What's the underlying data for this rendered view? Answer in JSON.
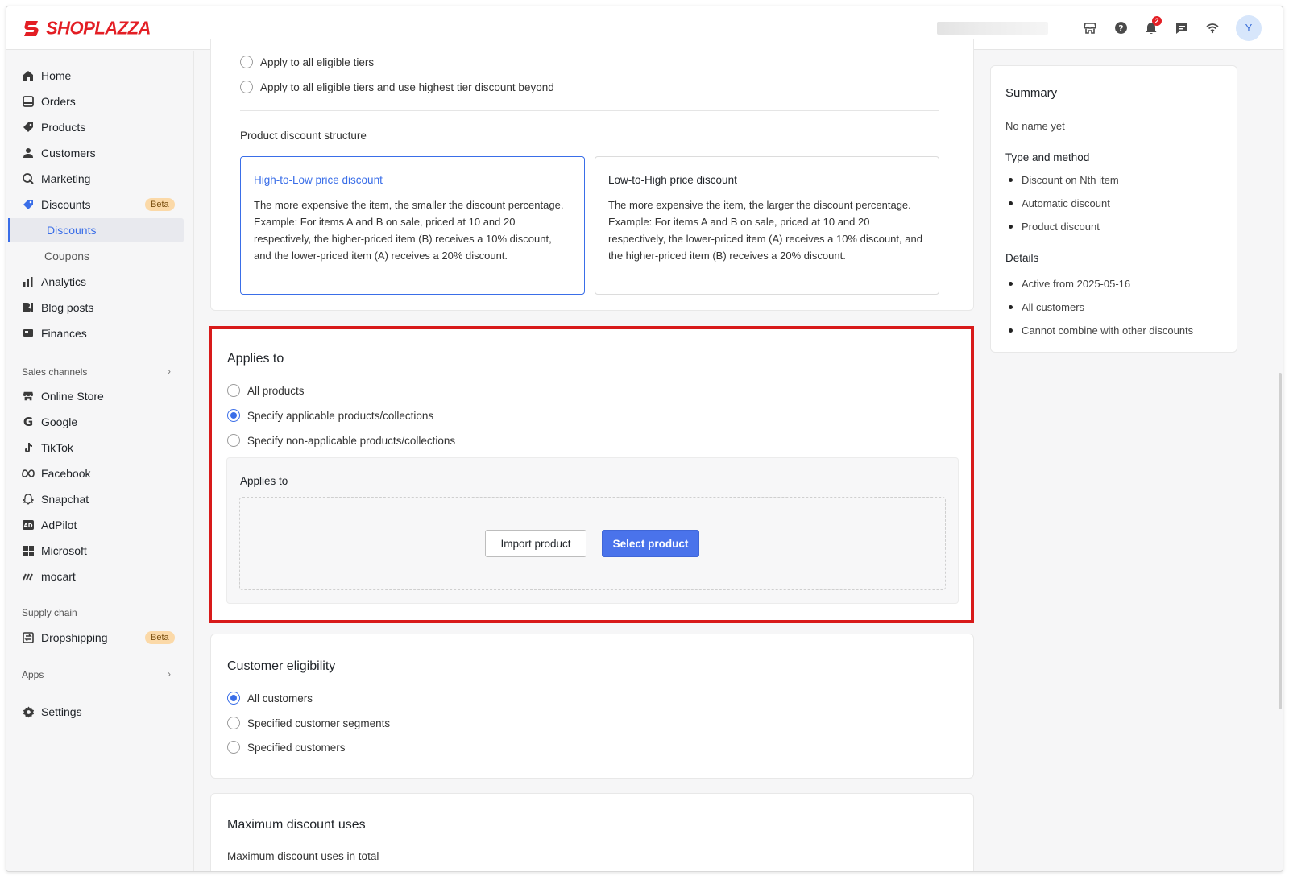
{
  "brand": {
    "name": "SHOPLAZZA",
    "color": "#e31e24"
  },
  "topbar": {
    "notification_count": "2",
    "avatar_initial": "Y",
    "icons": [
      "store-icon",
      "help-icon",
      "bell-icon",
      "message-icon",
      "wifi-icon"
    ]
  },
  "sidebar": {
    "items": [
      {
        "label": "Home",
        "icon": "home-icon"
      },
      {
        "label": "Orders",
        "icon": "orders-icon"
      },
      {
        "label": "Products",
        "icon": "tag-icon"
      },
      {
        "label": "Customers",
        "icon": "person-icon"
      },
      {
        "label": "Marketing",
        "icon": "marketing-icon"
      },
      {
        "label": "Discounts",
        "icon": "discount-icon",
        "badge": "Beta"
      },
      {
        "label": "Discounts",
        "sub": true,
        "active": true
      },
      {
        "label": "Coupons",
        "sub": true
      },
      {
        "label": "Analytics",
        "icon": "bar-chart-icon"
      },
      {
        "label": "Blog posts",
        "icon": "blog-icon"
      },
      {
        "label": "Finances",
        "icon": "finance-icon"
      }
    ],
    "sales_channels_label": "Sales channels",
    "channels": [
      {
        "label": "Online Store",
        "icon": "store-icon"
      },
      {
        "label": "Google",
        "icon": "google-icon"
      },
      {
        "label": "TikTok",
        "icon": "tiktok-icon"
      },
      {
        "label": "Facebook",
        "icon": "meta-icon"
      },
      {
        "label": "Snapchat",
        "icon": "snapchat-icon"
      },
      {
        "label": "AdPilot",
        "icon": "adpilot-icon"
      },
      {
        "label": "Microsoft",
        "icon": "microsoft-icon"
      },
      {
        "label": "mocart",
        "icon": "mocart-icon"
      }
    ],
    "supply_chain_label": "Supply chain",
    "supply": [
      {
        "label": "Dropshipping",
        "icon": "dropshipping-icon",
        "badge": "Beta"
      }
    ],
    "apps_label": "Apps",
    "settings_label": "Settings"
  },
  "tiers_card": {
    "options": [
      "Apply to all eligible tiers",
      "Apply to all eligible tiers and use highest tier discount beyond"
    ],
    "structure_label": "Product discount structure",
    "structures": [
      {
        "title": "High-to-Low price discount",
        "desc": "The more expensive the item, the smaller the discount percentage.",
        "example": "Example: For items A and B on sale, priced at 10 and 20 respectively, the higher-priced item (B) receives a 10% discount, and the lower-priced item (A) receives a 20% discount.",
        "selected": true
      },
      {
        "title": "Low-to-High price discount",
        "desc": "The more expensive the item, the larger the discount percentage.",
        "example": "Example: For items A and B on sale, priced at 10 and 20 respectively, the lower-priced item (A) receives a 10% discount, and the higher-priced item (B) receives a 20% discount.",
        "selected": false
      }
    ]
  },
  "applies_to": {
    "title": "Applies to",
    "options": [
      "All products",
      "Specify applicable products/collections",
      "Specify non-applicable products/collections"
    ],
    "selected_index": 1,
    "panel_label": "Applies to",
    "import_label": "Import product",
    "select_label": "Select product",
    "highlight_color": "#d81a1a"
  },
  "customer_eligibility": {
    "title": "Customer eligibility",
    "options": [
      "All customers",
      "Specified customer segments",
      "Specified customers"
    ],
    "selected_index": 0
  },
  "max_uses": {
    "title": "Maximum discount uses",
    "sub": "Maximum discount uses in total"
  },
  "summary": {
    "title": "Summary",
    "name": "No name yet",
    "type_head": "Type and method",
    "type_items": [
      "Discount on Nth item",
      "Automatic discount",
      "Product discount"
    ],
    "details_head": "Details",
    "details_items": [
      "Active from 2025-05-16",
      "All customers",
      "Cannot combine with other discounts"
    ]
  },
  "accent_color": "#3a6ee8"
}
